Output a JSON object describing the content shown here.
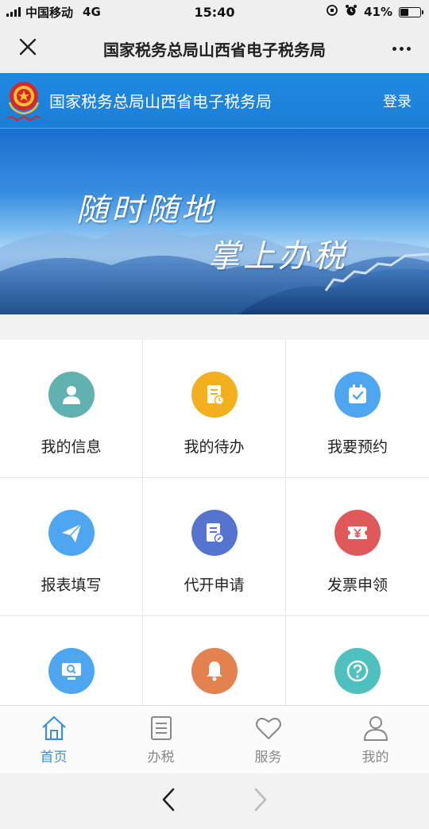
{
  "status_bar": {
    "carrier": "中国移动",
    "network": "4G",
    "time": "15:40",
    "battery": "41%",
    "battery_level": 0.41
  },
  "title_bar": {
    "title": "国家税务总局山西省电子税务局"
  },
  "header": {
    "title": "国家税务总局山西省电子税务局",
    "login_label": "登录"
  },
  "banner": {
    "line1": "随时随地",
    "line2": "掌上办税"
  },
  "grid": {
    "items": [
      {
        "label": "我的信息",
        "icon": "user-icon",
        "color": "#5fb2b0"
      },
      {
        "label": "我的待办",
        "icon": "document-clock-icon",
        "color": "#f2b01e"
      },
      {
        "label": "我要预约",
        "icon": "calendar-check-icon",
        "color": "#4ea6f0"
      },
      {
        "label": "报表填写",
        "icon": "paper-plane-icon",
        "color": "#4ea6f0"
      },
      {
        "label": "代开申请",
        "icon": "document-edit-icon",
        "color": "#5574cf"
      },
      {
        "label": "发票申领",
        "icon": "invoice-yen-icon",
        "color": "#e0585a"
      },
      {
        "label": "",
        "icon": "monitor-search-icon",
        "color": "#4ea6f0"
      },
      {
        "label": "",
        "icon": "bell-icon",
        "color": "#e3814f"
      },
      {
        "label": "",
        "icon": "help-icon",
        "color": "#4fc0c0"
      }
    ]
  },
  "tabbar": {
    "tabs": [
      {
        "label": "首页",
        "icon": "home-icon",
        "active": true
      },
      {
        "label": "办税",
        "icon": "list-icon",
        "active": false
      },
      {
        "label": "服务",
        "icon": "heart-icon",
        "active": false
      },
      {
        "label": "我的",
        "icon": "person-icon",
        "active": false
      }
    ]
  },
  "colors": {
    "accent": "#3a8fe0",
    "header_bg": "#1e89e1"
  }
}
